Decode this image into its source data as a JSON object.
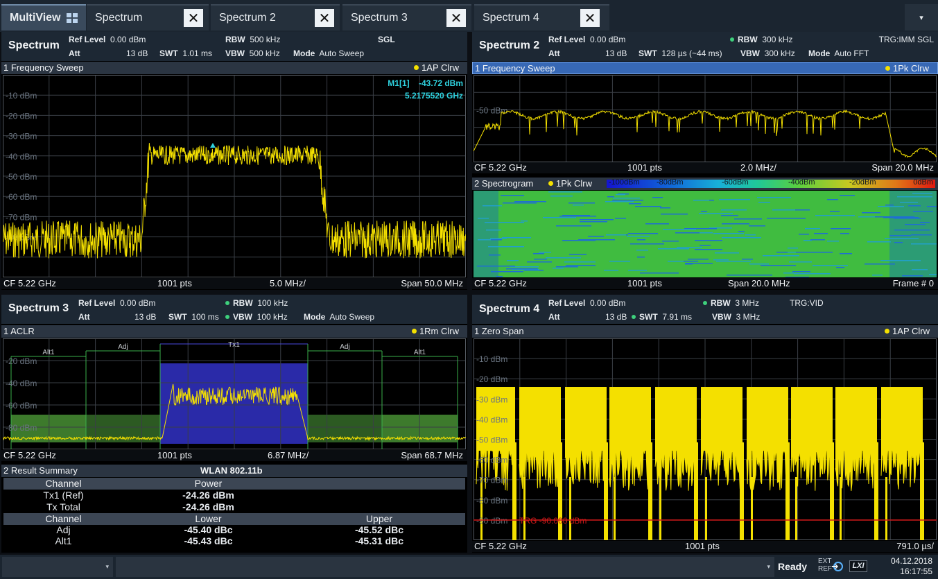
{
  "tabs": [
    {
      "label": "MultiView",
      "active": true
    },
    {
      "label": "Spectrum"
    },
    {
      "label": "Spectrum 2"
    },
    {
      "label": "Spectrum 3"
    },
    {
      "label": "Spectrum 4"
    }
  ],
  "tab_close_glyph": "✕",
  "tab_menu_glyph": "▾",
  "w1": {
    "title": "Spectrum",
    "ref_label": "Ref Level",
    "ref_val": "0.00 dBm",
    "att_label": "Att",
    "att_val": "13 dB",
    "swt_label": "SWT",
    "swt_val": "1.01 ms",
    "rbw_label": "RBW",
    "rbw_val": "500 kHz",
    "vbw_label": "VBW",
    "vbw_val": "500 kHz",
    "mode_label": "Mode",
    "mode_val": "Auto Sweep",
    "sgl": "SGL",
    "diag_title": "1 Frequency Sweep",
    "trace": "1AP Clrw",
    "marker_name": "M1[1]",
    "marker_level": "-43.72 dBm",
    "marker_freq": "5.2175520 GHz",
    "footer": {
      "cf": "CF 5.22 GHz",
      "pts": "1001 pts",
      "div": "5.0 MHz/",
      "span": "Span 50.0 MHz"
    },
    "ylabels": [
      "-10 dBm",
      "-20 dBm",
      "-30 dBm",
      "-40 dBm",
      "-50 dBm",
      "-60 dBm",
      "-70 dBm",
      "-80 dBm"
    ]
  },
  "w2": {
    "title": "Spectrum 2",
    "ref_label": "Ref Level",
    "ref_val": "0.00 dBm",
    "att_label": "Att",
    "att_val": "13 dB",
    "swt_label": "SWT",
    "swt_val": "128 µs (~44 ms)",
    "rbw_label": "RBW",
    "rbw_val": "300 kHz",
    "vbw_label": "VBW",
    "vbw_val": "300 kHz",
    "mode_label": "Mode",
    "mode_val": "Auto FFT",
    "trg": "TRG:IMM SGL",
    "diag_title": "1 Frequency Sweep",
    "trace": "1Pk Clrw",
    "ylabels": [
      "-50 dBm"
    ],
    "footer": {
      "cf": "CF 5.22 GHz",
      "pts": "1001 pts",
      "div": "2.0 MHz/",
      "span": "Span 20.0 MHz"
    },
    "spec_title": "2 Spectrogram",
    "spec_trace": "1Pk Clrw",
    "colorbar": [
      "-100dBm",
      "-80dBm",
      "-60dBm",
      "-40dBm",
      "-20dBm",
      "0dBm"
    ],
    "spec_footer": {
      "cf": "CF 5.22 GHz",
      "pts": "1001 pts",
      "span": "Span 20.0 MHz",
      "frame": "Frame # 0"
    }
  },
  "w3": {
    "title": "Spectrum 3",
    "ref_label": "Ref Level",
    "ref_val": "0.00 dBm",
    "att_label": "Att",
    "att_val": "13 dB",
    "swt_label": "SWT",
    "swt_val": "100 ms",
    "rbw_label": "RBW",
    "rbw_val": "100 kHz",
    "vbw_label": "VBW",
    "vbw_val": "100 kHz",
    "mode_label": "Mode",
    "mode_val": "Auto Sweep",
    "diag_title": "1 ACLR",
    "trace": "1Rm Clrw",
    "channel_labels": [
      "Alt1",
      "Adj",
      "Tx1",
      "Adj",
      "Alt1"
    ],
    "ylabels": [
      "-20 dBm",
      "-40 dBm",
      "-60 dBm",
      "-80 dBm"
    ],
    "footer": {
      "cf": "CF 5.22 GHz",
      "pts": "1001 pts",
      "div": "6.87 MHz/",
      "span": "Span 68.7 MHz"
    },
    "rs_title": "2 Result Summary",
    "rs_std": "WLAN 802.11b",
    "rs_head1": [
      "Channel",
      "Power",
      ""
    ],
    "rs_rows1": [
      [
        "Tx1 (Ref)",
        "-24.26 dBm"
      ],
      [
        "Tx Total",
        "-24.26 dBm"
      ]
    ],
    "rs_head2": [
      "Channel",
      "Lower",
      "Upper"
    ],
    "rs_rows2": [
      [
        "Adj",
        "-45.40 dBc",
        "-45.52 dBc"
      ],
      [
        "Alt1",
        "-45.43 dBc",
        "-45.31 dBc"
      ]
    ]
  },
  "w4": {
    "title": "Spectrum 4",
    "ref_label": "Ref Level",
    "ref_val": "0.00 dBm",
    "att_label": "Att",
    "att_val": "13 dB",
    "swt_label": "SWT",
    "swt_val": "7.91 ms",
    "rbw_label": "RBW",
    "rbw_val": "3 MHz",
    "vbw_label": "VBW",
    "vbw_val": "3 MHz",
    "trg": "TRG:VID",
    "diag_title": "1 Zero Span",
    "trace": "1AP Clrw",
    "ylabels": [
      "-10 dBm",
      "-20 dBm",
      "-30 dBm",
      "-40 dBm",
      "-50 dBm",
      "-60 dBm",
      "-70 dBm",
      "-80 dBm",
      "-90 dBm"
    ],
    "trg_line": "TRG -90.000 dBm",
    "footer": {
      "cf": "CF 5.22 GHz",
      "pts": "1001 pts",
      "div": "791.0 µs/"
    }
  },
  "status": {
    "ready": "Ready",
    "ext": "EXT",
    "ref": "REF",
    "lxi": "LXI",
    "date": "04.12.2018",
    "time": "16:17:55"
  },
  "colors": {
    "trace": "#f4e000",
    "marker": "#2fd3e0",
    "accent": "#3768b5",
    "tx_fill": "#2a2aa8",
    "adj_fill": "#3d7a2c",
    "trigger": "#d01818"
  }
}
